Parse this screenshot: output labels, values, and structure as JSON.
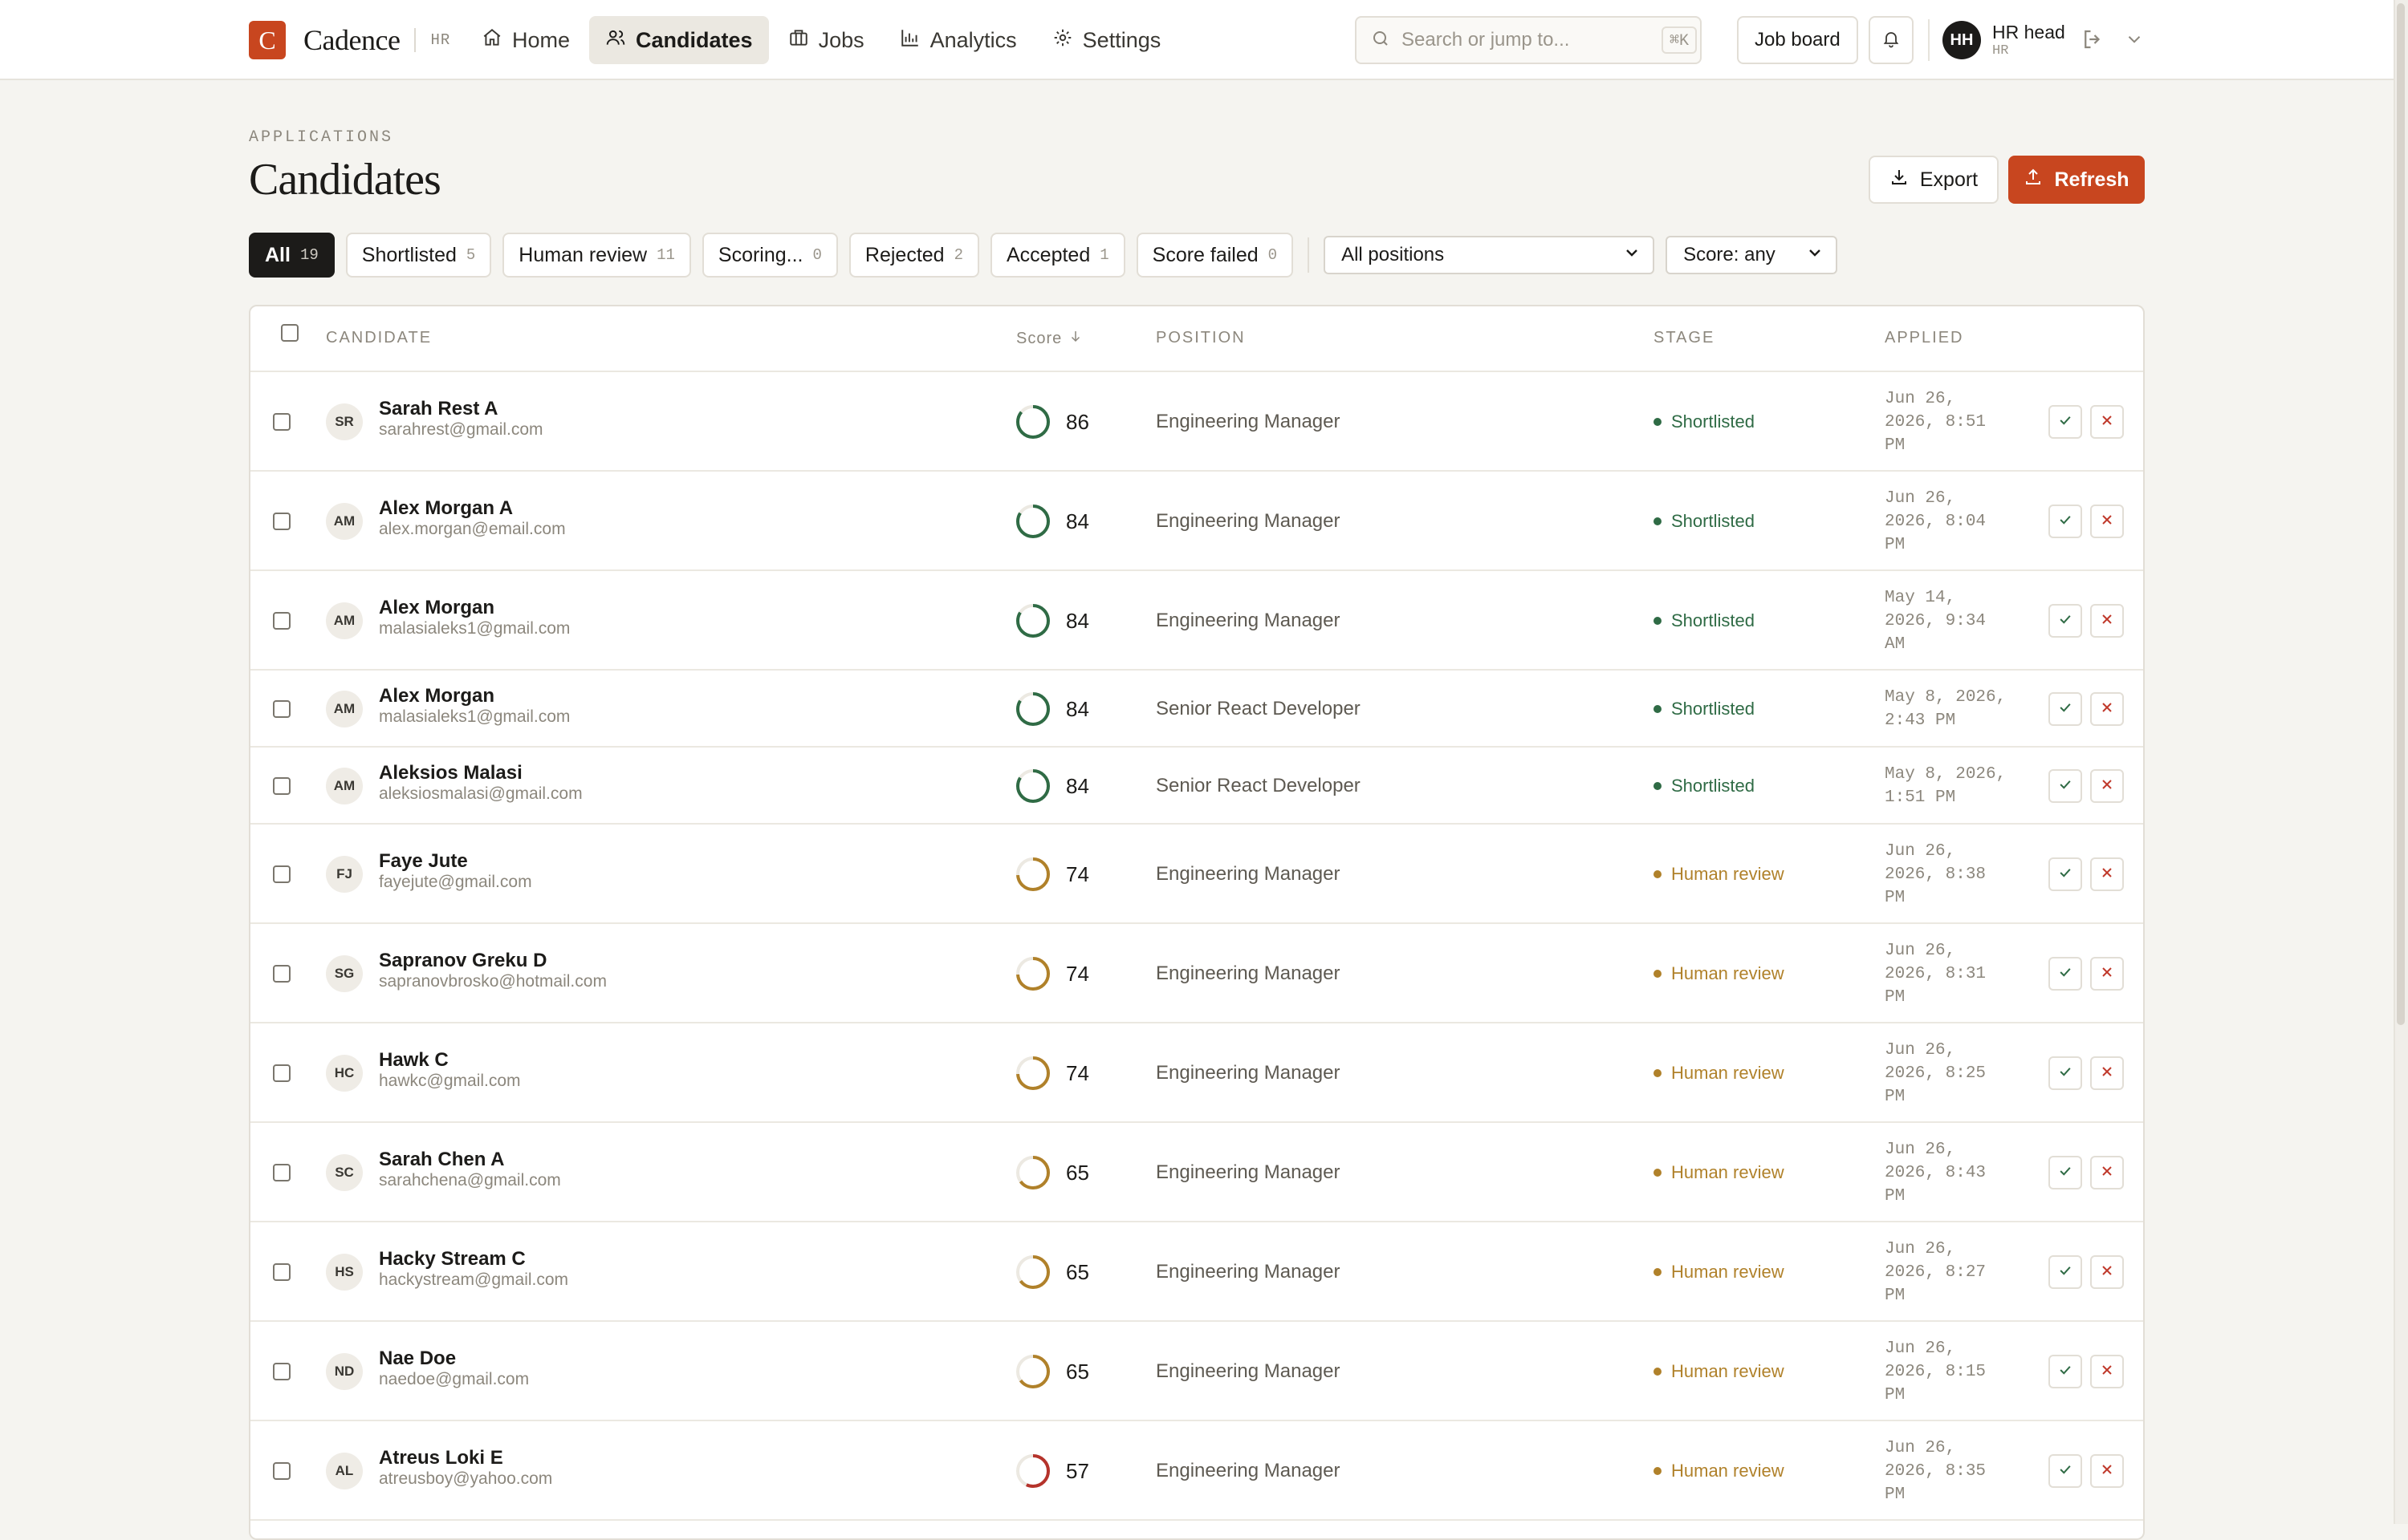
{
  "brand": {
    "mark": "C",
    "name": "Cadence",
    "tag": "HR"
  },
  "nav": [
    {
      "label": "Home",
      "icon": "home-icon",
      "active": false
    },
    {
      "label": "Candidates",
      "icon": "users-icon",
      "active": true
    },
    {
      "label": "Jobs",
      "icon": "briefcase-icon",
      "active": false
    },
    {
      "label": "Analytics",
      "icon": "bar-chart-icon",
      "active": false
    },
    {
      "label": "Settings",
      "icon": "gear-icon",
      "active": false
    }
  ],
  "search": {
    "placeholder": "Search or jump to...",
    "shortcut": "⌘K"
  },
  "header_actions": {
    "job_board": "Job board"
  },
  "user": {
    "initials": "HH",
    "name": "HR head",
    "role": "HR"
  },
  "page": {
    "eyebrow": "APPLICATIONS",
    "title": "Candidates",
    "export": "Export",
    "refresh": "Refresh"
  },
  "filters": [
    {
      "label": "All",
      "count": "19",
      "active": true
    },
    {
      "label": "Shortlisted",
      "count": "5",
      "active": false
    },
    {
      "label": "Human review",
      "count": "11",
      "active": false
    },
    {
      "label": "Scoring...",
      "count": "0",
      "active": false
    },
    {
      "label": "Rejected",
      "count": "2",
      "active": false
    },
    {
      "label": "Accepted",
      "count": "1",
      "active": false
    },
    {
      "label": "Score failed",
      "count": "0",
      "active": false
    }
  ],
  "selects": {
    "position": "All positions",
    "score": "Score: any"
  },
  "columns": {
    "candidate": "CANDIDATE",
    "score": "Score",
    "position": "POSITION",
    "stage": "STAGE",
    "applied": "APPLIED"
  },
  "colors": {
    "accent": "#c8461f",
    "shortlisted": "#2f6b45",
    "human_review": "#b0812a",
    "low_score": "#b5332b",
    "reject": "#c0392b"
  },
  "candidates": [
    {
      "initials": "SR",
      "name": "Sarah Rest A",
      "email": "sarahrest@gmail.com",
      "score": 86,
      "position": "Engineering Manager",
      "stage": "Shortlisted",
      "applied": [
        "Jun 26,",
        "2026, 8:51",
        "PM"
      ]
    },
    {
      "initials": "AM",
      "name": "Alex Morgan A",
      "email": "alex.morgan@email.com",
      "score": 84,
      "position": "Engineering Manager",
      "stage": "Shortlisted",
      "applied": [
        "Jun 26,",
        "2026, 8:04",
        "PM"
      ]
    },
    {
      "initials": "AM",
      "name": "Alex Morgan",
      "email": "malasialeks1@gmail.com",
      "score": 84,
      "position": "Engineering Manager",
      "stage": "Shortlisted",
      "applied": [
        "May 14,",
        "2026, 9:34",
        "AM"
      ]
    },
    {
      "initials": "AM",
      "name": "Alex Morgan",
      "email": "malasialeks1@gmail.com",
      "score": 84,
      "position": "Senior React Developer",
      "stage": "Shortlisted",
      "applied": [
        "May 8, 2026,",
        "2:43 PM"
      ]
    },
    {
      "initials": "AM",
      "name": "Aleksios Malasi",
      "email": "aleksiosmalasi@gmail.com",
      "score": 84,
      "position": "Senior React Developer",
      "stage": "Shortlisted",
      "applied": [
        "May 8, 2026,",
        "1:51 PM"
      ]
    },
    {
      "initials": "FJ",
      "name": "Faye Jute",
      "email": "fayejute@gmail.com",
      "score": 74,
      "position": "Engineering Manager",
      "stage": "Human review",
      "applied": [
        "Jun 26,",
        "2026, 8:38",
        "PM"
      ]
    },
    {
      "initials": "SG",
      "name": "Sapranov Greku D",
      "email": "sapranovbrosko@hotmail.com",
      "score": 74,
      "position": "Engineering Manager",
      "stage": "Human review",
      "applied": [
        "Jun 26,",
        "2026, 8:31",
        "PM"
      ]
    },
    {
      "initials": "HC",
      "name": "Hawk C",
      "email": "hawkc@gmail.com",
      "score": 74,
      "position": "Engineering Manager",
      "stage": "Human review",
      "applied": [
        "Jun 26,",
        "2026, 8:25",
        "PM"
      ]
    },
    {
      "initials": "SC",
      "name": "Sarah Chen A",
      "email": "sarahchena@gmail.com",
      "score": 65,
      "position": "Engineering Manager",
      "stage": "Human review",
      "applied": [
        "Jun 26,",
        "2026, 8:43",
        "PM"
      ]
    },
    {
      "initials": "HS",
      "name": "Hacky Stream C",
      "email": "hackystream@gmail.com",
      "score": 65,
      "position": "Engineering Manager",
      "stage": "Human review",
      "applied": [
        "Jun 26,",
        "2026, 8:27",
        "PM"
      ]
    },
    {
      "initials": "ND",
      "name": "Nae Doe",
      "email": "naedoe@gmail.com",
      "score": 65,
      "position": "Engineering Manager",
      "stage": "Human review",
      "applied": [
        "Jun 26,",
        "2026, 8:15",
        "PM"
      ]
    },
    {
      "initials": "AL",
      "name": "Atreus Loki E",
      "email": "atreusboy@yahoo.com",
      "score": 57,
      "position": "Engineering Manager",
      "stage": "Human review",
      "applied": [
        "Jun 26,",
        "2026, 8:35",
        "PM"
      ]
    }
  ]
}
